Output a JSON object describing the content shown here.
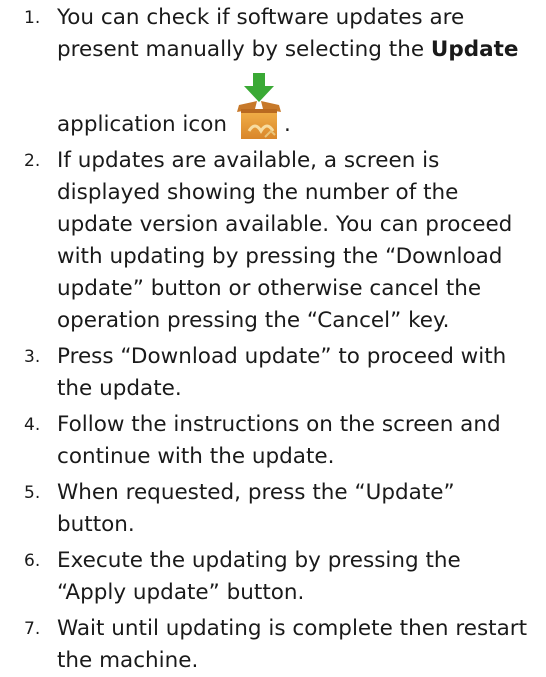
{
  "steps": [
    {
      "num": "1.",
      "text_before_bold": "You can check if software updates are present manually by selecting the ",
      "bold": "Update",
      "text_after_icon_prefix": "application icon",
      "text_after_icon_suffix": ".",
      "icon": "update-box-download-icon"
    },
    {
      "num": "2.",
      "text": "If updates are available, a screen is displayed showing the number of the update version available. You can proceed with updating by pressing the “Download update” button or otherwise cancel the operation pressing the “Cancel” key."
    },
    {
      "num": "3.",
      "text": "Press “Download update” to proceed with the update."
    },
    {
      "num": "4.",
      "text": "Follow the instructions on the screen and continue with the update."
    },
    {
      "num": "5.",
      "text": "When requested, press the “Update” button."
    },
    {
      "num": "6.",
      "text": "Execute the updating by pressing the “Apply update” button."
    },
    {
      "num": "7.",
      "text": "Wait until updating is complete then restart the machine."
    }
  ],
  "colors": {
    "text": "#1a1a1a",
    "icon_arrow": "#3aa935",
    "icon_box": "#e8a33a"
  }
}
